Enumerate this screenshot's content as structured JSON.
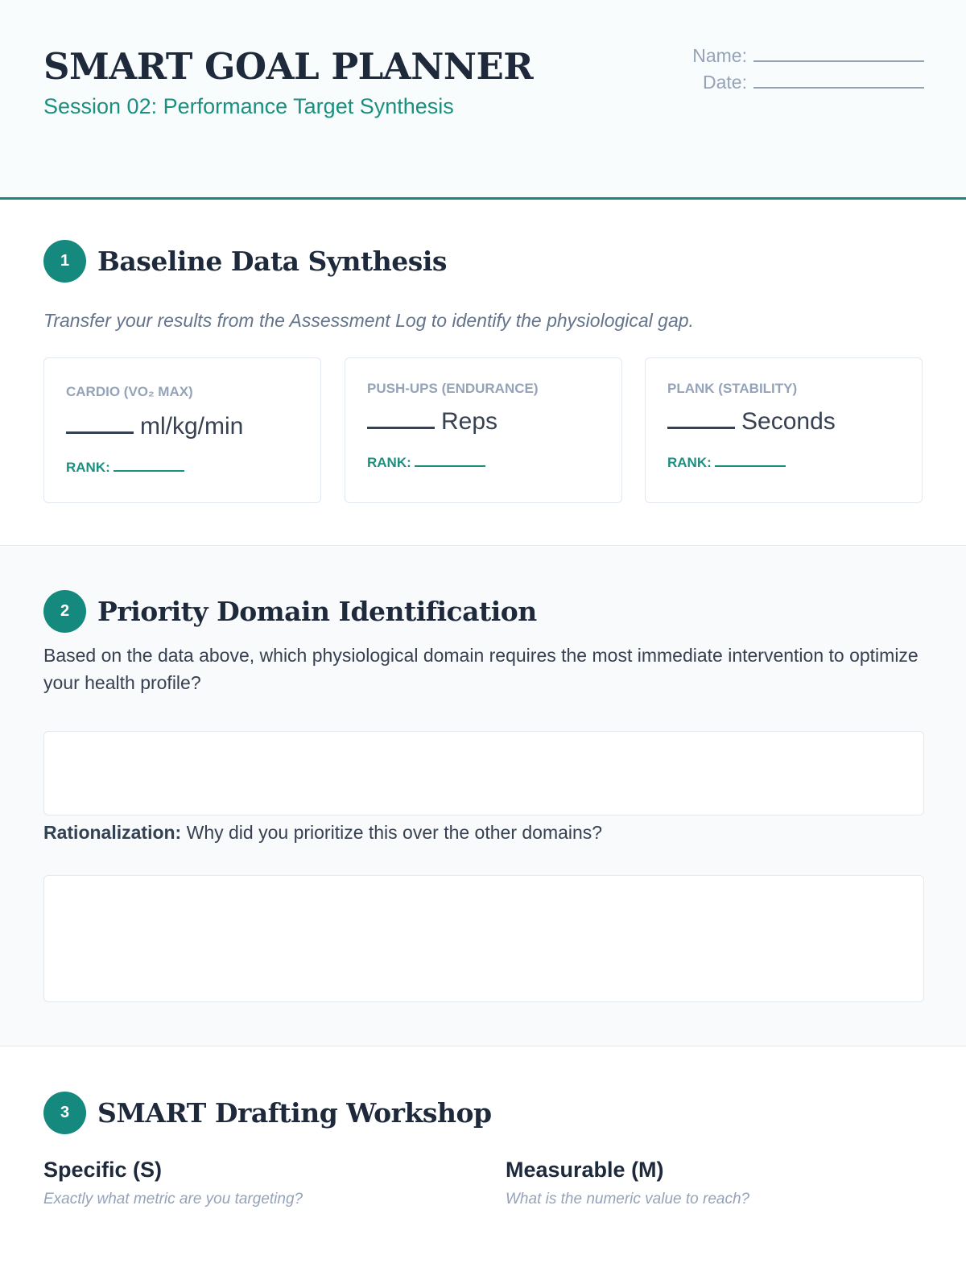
{
  "header": {
    "title": "SMART GOAL PLANNER",
    "subtitle": "Session 02: Performance Target Synthesis",
    "name_label": "Name:",
    "date_label": "Date:"
  },
  "section1": {
    "number": "1",
    "title": "Baseline Data Synthesis",
    "intro": "Transfer your results from the Assessment Log to identify the physiological gap.",
    "cards": [
      {
        "label": "CARDIO (VO₂ MAX)",
        "unit": "ml/kg/min",
        "rank_label": "RANK:"
      },
      {
        "label": "PUSH-UPS (ENDURANCE)",
        "unit": "Reps",
        "rank_label": "RANK:"
      },
      {
        "label": "PLANK (STABILITY)",
        "unit": "Seconds",
        "rank_label": "RANK:"
      }
    ]
  },
  "section2": {
    "number": "2",
    "title": "Priority Domain Identification",
    "prompt": "Based on the data above, which physiological domain requires the most immediate intervention to optimize your health profile?",
    "rationalization_label": "Rationalization:",
    "rationalization_prompt": " Why did you prioritize this over the other domains?"
  },
  "section3": {
    "number": "3",
    "title": "SMART Drafting Workshop",
    "columns": [
      {
        "title": "Specific (S)",
        "hint": "Exactly what metric are you targeting?"
      },
      {
        "title": "Measurable (M)",
        "hint": "What is the numeric value to reach?"
      }
    ]
  },
  "colors": {
    "accent": "#15897e",
    "heading": "#1e293b",
    "muted": "#94a3b8"
  }
}
